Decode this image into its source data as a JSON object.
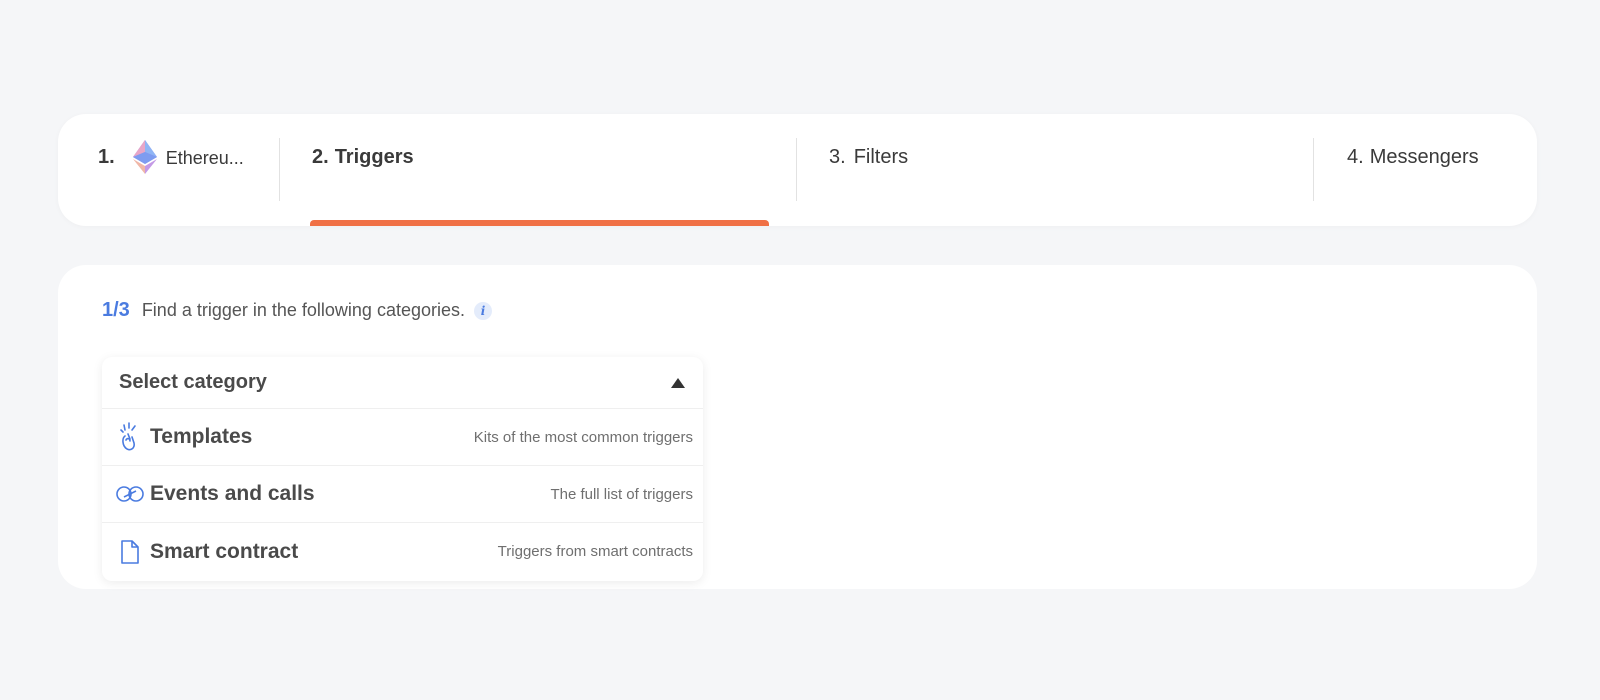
{
  "steps": [
    {
      "num": "1.",
      "label": "Ethereu...",
      "icon": "ethereum-icon"
    },
    {
      "num": "2.",
      "label": "Triggers"
    },
    {
      "num": "3.",
      "label": "Filters"
    },
    {
      "num": "4.",
      "label": "Messengers"
    }
  ],
  "active_step": 2,
  "accent_color": "#f07045",
  "progress": {
    "count": "1/3",
    "hint": "Find a trigger in the following categories.",
    "info_icon": "i"
  },
  "dropdown": {
    "placeholder": "Select category",
    "options": [
      {
        "name": "Templates",
        "desc": "Kits of the most common triggers",
        "icon": "snap-fingers-icon"
      },
      {
        "name": "Events and calls",
        "desc": "The full list of triggers",
        "icon": "infinity-icon"
      },
      {
        "name": "Smart contract",
        "desc": "Triggers from smart contracts",
        "icon": "document-icon"
      }
    ]
  }
}
